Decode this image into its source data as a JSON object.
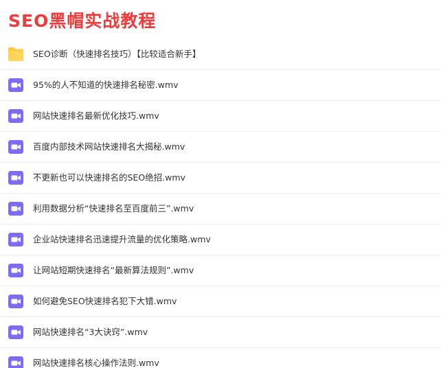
{
  "title": "SEO黑帽实战教程",
  "colors": {
    "title": "#f03b3b",
    "folder": "#ffc93b",
    "video": "#7b6cf0"
  },
  "items": [
    {
      "type": "folder",
      "icon": "folder-icon",
      "label": "SEO诊断（快速排名技巧）【比较适合新手】"
    },
    {
      "type": "video",
      "icon": "video-file-icon",
      "label": "95%的人不知道的快速排名秘密.wmv"
    },
    {
      "type": "video",
      "icon": "video-file-icon",
      "label": "网站快速排名最新优化技巧.wmv"
    },
    {
      "type": "video",
      "icon": "video-file-icon",
      "label": "百度内部技术网站快速排名大揭秘.wmv"
    },
    {
      "type": "video",
      "icon": "video-file-icon",
      "label": "不更新也可以快速排名的SEO绝招.wmv"
    },
    {
      "type": "video",
      "icon": "video-file-icon",
      "label": "利用数据分析“快速排名至百度前三”.wmv"
    },
    {
      "type": "video",
      "icon": "video-file-icon",
      "label": "企业站快速排名迅速提升流量的优化策略.wmv"
    },
    {
      "type": "video",
      "icon": "video-file-icon",
      "label": "让网站短期快速排名“最新算法规则”.wmv"
    },
    {
      "type": "video",
      "icon": "video-file-icon",
      "label": "如何避免SEO快速排名犯下大错.wmv"
    },
    {
      "type": "video",
      "icon": "video-file-icon",
      "label": "网站快速排名“3大诀窍”.wmv"
    },
    {
      "type": "video",
      "icon": "video-file-icon",
      "label": "网站快速排名核心操作法则.wmv"
    }
  ]
}
